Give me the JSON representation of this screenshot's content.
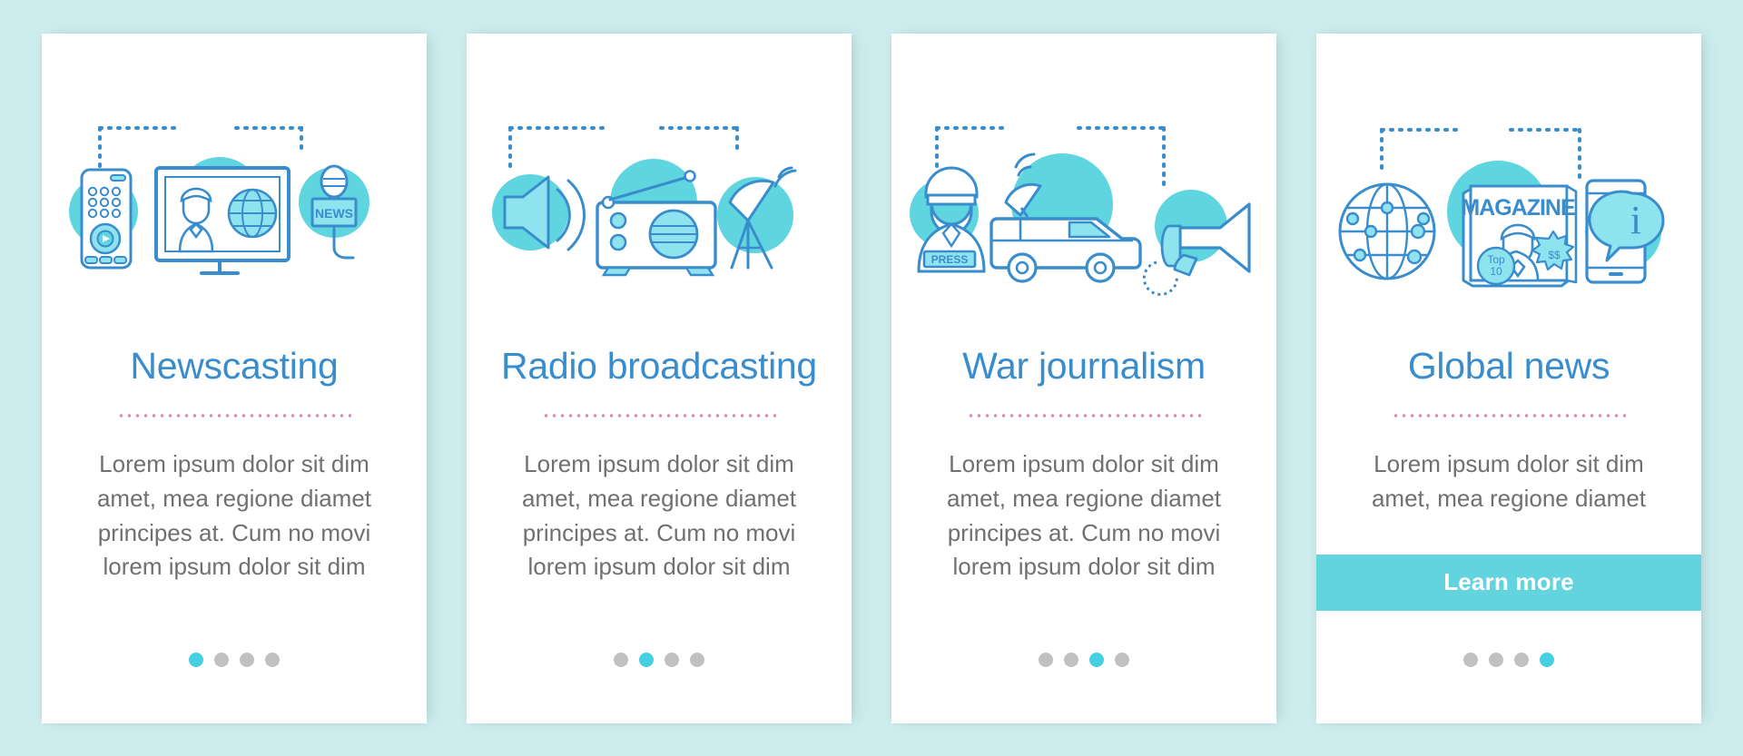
{
  "page": {
    "background_color": "#cdeced",
    "card_background": "#ffffff",
    "title_color": "#3a8dcc",
    "body_color": "#6f7072",
    "accent_color": "#63d3de",
    "divider_color": "#d98cb8",
    "dot_active_color": "#46cfe0",
    "dot_inactive_color": "#bfc1c3",
    "icon_line_color": "#3a8dcc",
    "icon_fill_color": "#8fe3ef",
    "icon_blob_color": "#5fd5e0"
  },
  "cards": [
    {
      "title": "Newscasting",
      "body": "Lorem ipsum dolor sit dim amet, mea regione diamet principes at. Cum no movi lorem ipsum dolor sit dim",
      "icons": [
        "remote-control-icon",
        "tv-news-anchor-icon",
        "news-microphone-icon"
      ],
      "icon_labels": {
        "microphone_sign": "NEWS"
      },
      "has_cta": false,
      "cta_label": "",
      "dots": {
        "count": 4,
        "active_index": 0
      }
    },
    {
      "title": "Radio broadcasting",
      "body": "Lorem ipsum dolor sit dim amet, mea regione diamet principes at. Cum no movi lorem ipsum dolor sit dim",
      "icons": [
        "loudspeaker-icon",
        "radio-receiver-icon",
        "satellite-dish-icon"
      ],
      "icon_labels": {},
      "has_cta": false,
      "cta_label": "",
      "dots": {
        "count": 4,
        "active_index": 1
      }
    },
    {
      "title": "War journalism",
      "body": "Lorem ipsum dolor sit dim amet, mea regione diamet principes at. Cum no movi lorem ipsum dolor sit dim",
      "icons": [
        "press-reporter-icon",
        "satellite-news-van-icon",
        "megaphone-icon"
      ],
      "icon_labels": {
        "vest_badge": "PRESS"
      },
      "has_cta": false,
      "cta_label": "",
      "dots": {
        "count": 4,
        "active_index": 2
      }
    },
    {
      "title": "Global news",
      "body": "Lorem ipsum dolor sit dim amet, mea regione diamet",
      "icons": [
        "globe-network-icon",
        "magazine-icon",
        "smartphone-info-icon"
      ],
      "icon_labels": {
        "magazine_cover": "MAGAZINE",
        "top_badge_line1": "Top",
        "top_badge_line2": "10",
        "price_badge": "$$",
        "info_glyph": "i"
      },
      "has_cta": true,
      "cta_label": "Learn more",
      "dots": {
        "count": 4,
        "active_index": 3
      }
    }
  ]
}
